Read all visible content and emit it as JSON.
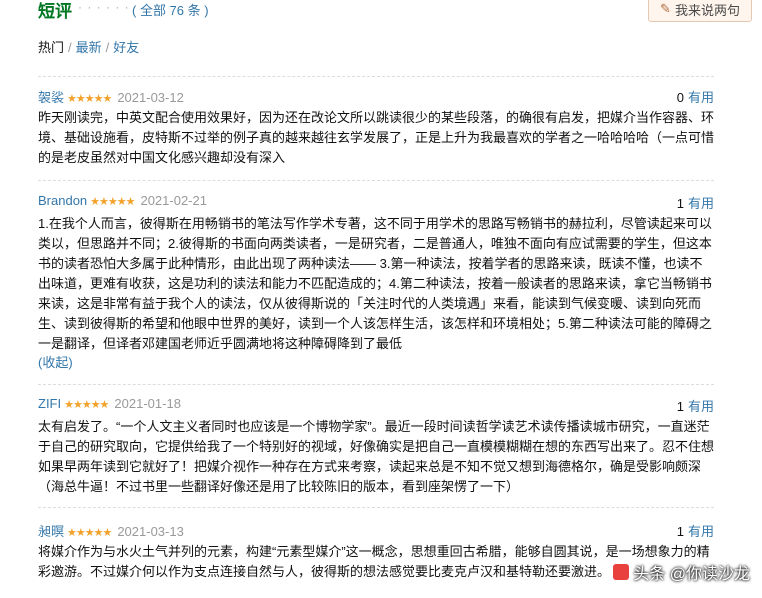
{
  "header": {
    "title": "短评",
    "dots": "· · · · · ·",
    "count_text": "( 全部 76 条 )",
    "write_button_label": "我来说两句"
  },
  "sort": {
    "hot": "热门",
    "latest": "最新",
    "friends": "好友",
    "separator": "/"
  },
  "reviews": [
    {
      "user": "袈裟",
      "stars": "★★★★★",
      "rating": 5,
      "date": "2021-03-12",
      "useful_count": "0",
      "useful_label": "有用",
      "text": "昨天刚读完，中英文配合使用效果好，因为还在改论文所以跳读很少的某些段落，的确很有启发，把媒介当作容器、环境、基础设施看，皮特斯不过举的例子真的越来越往玄学发展了，正是上升为我最喜欢的学者之一哈哈哈哈（一点可惜的是老皮虽然对中国文化感兴趣却没有深入"
    },
    {
      "user": "Brandon",
      "stars": "★★★★★",
      "rating": 5,
      "date": "2021-02-21",
      "useful_count": "1",
      "useful_label": "有用",
      "text": "1.在我个人而言，彼得斯在用畅销书的笔法写作学术专著，这不同于用学术的思路写畅销书的赫拉利，尽管读起来可以类以，但思路并不同；2.彼得斯的书面向两类读者，一是研究者，二是普通人，唯独不面向有应试需要的学生，但这本书的读者恐怕大多属于此种情形，由此出现了两种读法—— 3.第一种读法，按着学者的思路来读，既读不懂，也读不出味道，更难有收获，这是功利的读法和能力不匹配造成的；4.第二种读法，按着一般读者的思路来读，拿它当畅销书来读，这是非常有益于我个人的读法，仅从彼得斯说的「关注时代的人类境遇」来看，能读到气候变暖、读到向死而生、读到彼得斯的希望和他眼中世界的美好，读到一个人该怎样生活，该怎样和环境相处；5.第二种读法可能的障碍之一是翻译，但译者邓建国老师近乎圆满地将这种障碍降到了最低",
      "collapse_label": "(收起)"
    },
    {
      "user": "ZIFI",
      "stars": "★★★★★",
      "rating": 5,
      "date": "2021-01-18",
      "useful_count": "1",
      "useful_label": "有用",
      "text": "太有启发了。“一个人文主义者同时也应该是一个博物学家”。最近一段时间读哲学读艺术读传播读城市研究，一直迷茫于自己的研究取向，它提供给我了一个特别好的视域，好像确实是把自己一直模模糊糊在想的东西写出来了。忍不住想如果早两年读到它就好了！把媒介视作一种存在方式来考察，读起来总是不知不觉又想到海德格尔，确是受影响颇深（海总牛逼！不过书里一些翻译好像还是用了比较陈旧的版本，看到座架愣了一下）"
    },
    {
      "user": "昶暝",
      "stars": "★★★★★",
      "rating": 5,
      "date": "2021-03-13",
      "useful_count": "1",
      "useful_label": "有用",
      "text": "将媒介作为与水火土气并列的元素，构建“元素型媒介”这一概念，思想重回古希腊，能够自圆其说，是一场想象力的精彩邀游。不过媒介何以作为支点连接自然与人，彼得斯的想法感觉要比麦克卢汉和基特勒还要激进。"
    }
  ],
  "watermark": "头条 @你读沙龙"
}
